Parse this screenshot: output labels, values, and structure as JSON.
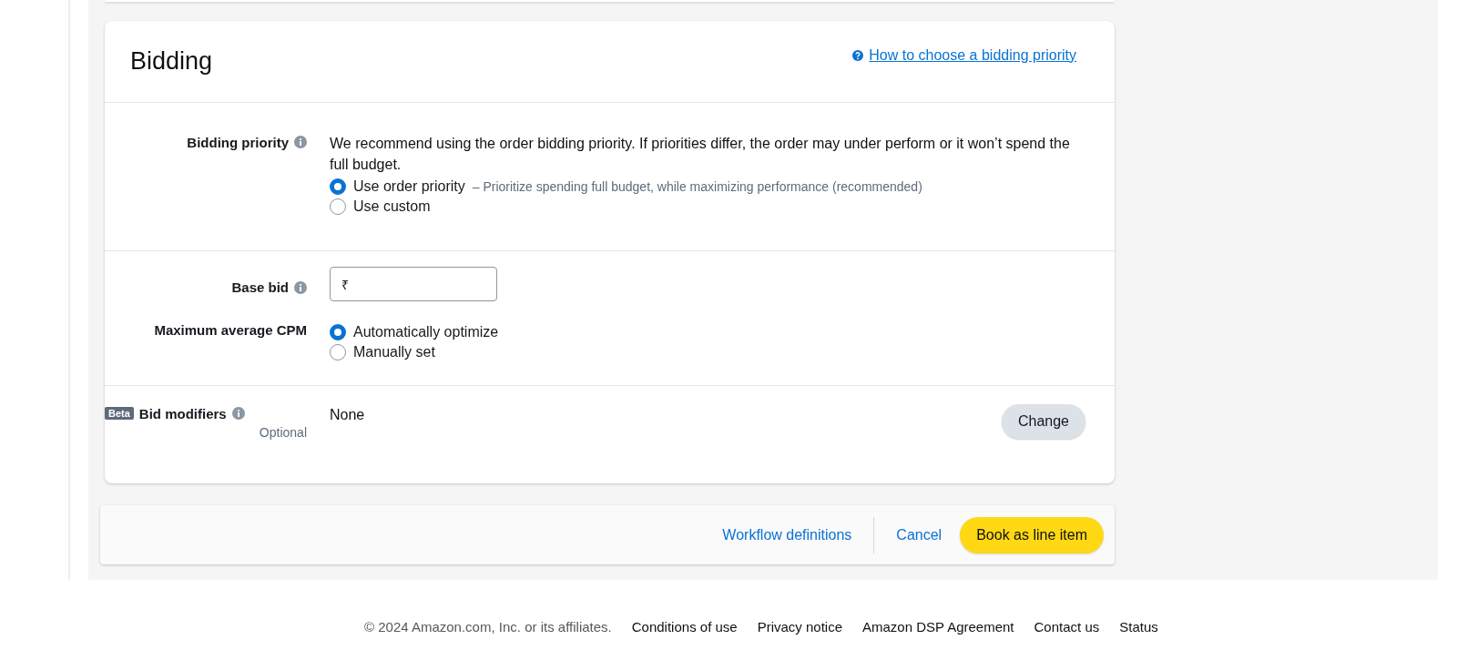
{
  "card": {
    "title": "Bidding",
    "help_link": "How to choose a bidding priority"
  },
  "bidding_priority": {
    "label": "Bidding priority",
    "description": "We recommend using the order bidding priority. If priorities differ, the order may under perform or it won’t spend the full budget.",
    "options": [
      {
        "label": "Use order priority",
        "note": "– Prioritize spending full budget, while maximizing performance (recommended)",
        "selected": true
      },
      {
        "label": "Use custom",
        "selected": false
      }
    ]
  },
  "base_bid": {
    "label": "Base bid",
    "currency_prefix": "₹"
  },
  "max_cpm": {
    "label": "Maximum average CPM",
    "options": [
      {
        "label": "Automatically optimize",
        "selected": true
      },
      {
        "label": "Manually set",
        "selected": false
      }
    ]
  },
  "bid_modifiers": {
    "badge": "Beta",
    "label": "Bid modifiers",
    "sublabel": "Optional",
    "value": "None",
    "button": "Change"
  },
  "action_bar": {
    "links": [
      "Workflow definitions",
      "Cancel"
    ],
    "primary_button": "Book as line item"
  },
  "page_footer": {
    "copyright": "© 2024 Amazon.com, Inc. or its affiliates.",
    "links": [
      "Conditions of use",
      "Privacy notice",
      "Amazon DSP Agreement",
      "Contact us",
      "Status"
    ]
  }
}
